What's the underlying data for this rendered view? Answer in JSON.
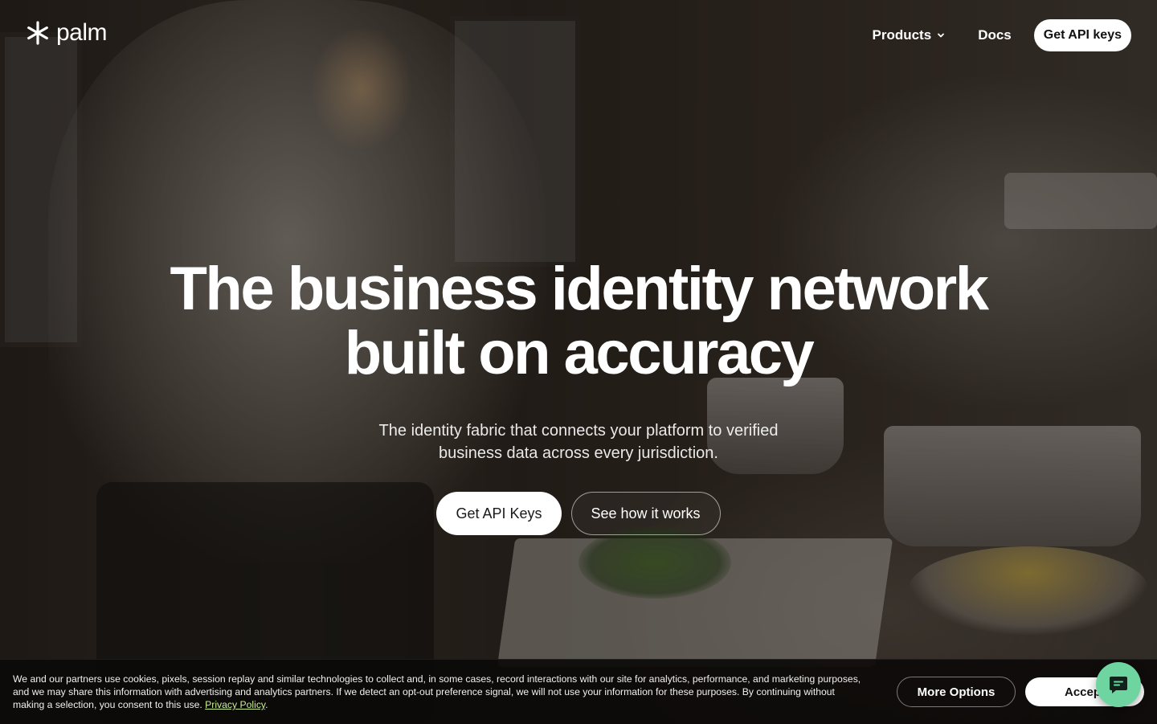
{
  "brand": {
    "name": "palm",
    "logo_icon": "asterisk-logo-icon"
  },
  "nav": {
    "products_label": "Products",
    "products_icon": "chevron-down-icon",
    "docs_label": "Docs",
    "cta_label": "Get API keys"
  },
  "hero": {
    "title_line1": "The business identity network",
    "title_line2": "built on accuracy",
    "subtitle": "The identity fabric that connects your platform to verified business data across every jurisdiction.",
    "primary_cta": "Get API Keys",
    "secondary_cta": "See how it works"
  },
  "cookie_banner": {
    "text": "We and our partners use cookies, pixels, session replay and similar technologies to collect and, in some cases, record interactions with our site for analytics, performance, and marketing purposes, and we may share this information with advertising and analytics partners. If we detect an opt-out preference signal, we will not use your information for these purposes. By continuing without making a selection, you consent to this use.",
    "link_text": "Privacy Policy",
    "after_link": ".",
    "more_options_label": "More Options",
    "accept_label": "Accept"
  },
  "chat": {
    "icon": "chat-bubble-icon"
  },
  "colors": {
    "accent_green": "#6fd5a0",
    "link_green": "#c8f08a",
    "overlay": "#0c0a09"
  }
}
